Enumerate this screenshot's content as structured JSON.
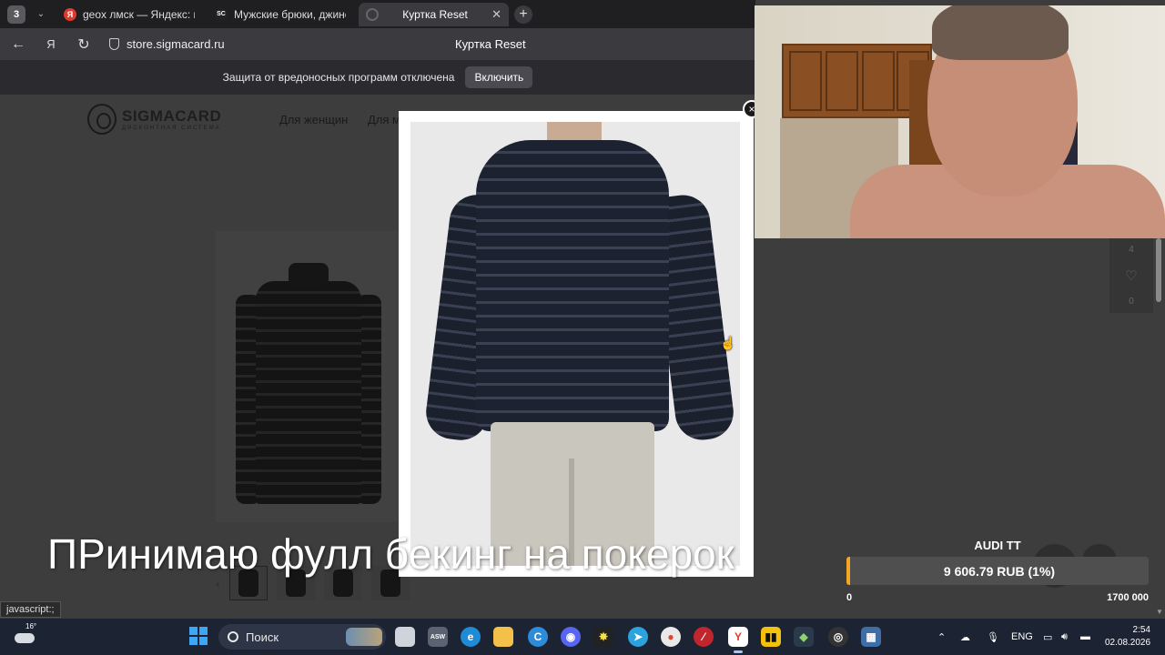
{
  "browser": {
    "tab_count": "3",
    "tabs": [
      {
        "favicon": "yandex-icon",
        "title": "geox лмск — Яндекс: наш"
      },
      {
        "favicon": "sigmacard-icon",
        "title": "Мужские брюки, джинсы"
      },
      {
        "favicon": "loading-icon",
        "title": "Куртка Reset"
      }
    ],
    "address": "store.sigmacard.ru",
    "page_title": "Куртка Reset",
    "infobar_text": "Защита от вредоносных программ отключена",
    "infobar_button": "Включить",
    "status_url": "javascript:;"
  },
  "site": {
    "logo_text": "SIGMACARD",
    "logo_sub": "ДИСКОНТНАЯ СИСТЕМА",
    "nav": [
      "Для женщин",
      "Для м"
    ],
    "side_count": "4",
    "side_fav_count": "0"
  },
  "modal": {
    "close_label": "×",
    "image_alt": "Jacket back view"
  },
  "overlay": {
    "caption": "ПРинимаю фулл бекинг на покерок",
    "donation": {
      "title": "AUDI TT",
      "amount": "9 606.79 RUB (1%)",
      "min": "0",
      "max": "1700 000",
      "progress_percent": 1,
      "accent_color": "#f5a623"
    }
  },
  "taskbar": {
    "weather_temp": "16°",
    "search_placeholder": "Поиск",
    "lang": "ENG",
    "time": "2:54",
    "date": "02.08.2026"
  },
  "colors": {
    "chrome_bg": "#1f1f22",
    "taskbar_bg": "#1c2433",
    "start_blue": "#3ea6f5"
  }
}
